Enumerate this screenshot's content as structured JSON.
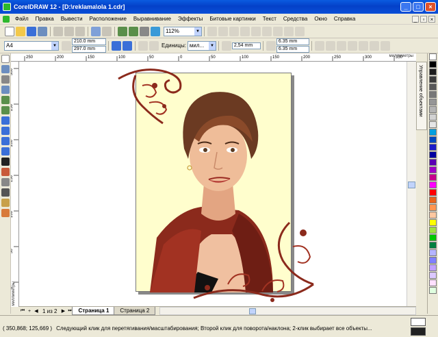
{
  "window": {
    "title": "CorelDRAW 12 - [D:\\reklama\\ola 1.cdr]"
  },
  "menu": [
    "Файл",
    "Правка",
    "Вывести",
    "Расположение",
    "Выравнивание",
    "Эффекты",
    "Битовые картинки",
    "Текст",
    "Средства",
    "Окно",
    "Справка"
  ],
  "toolbar1": {
    "zoom": "112%"
  },
  "toolbar2": {
    "paper": "A4",
    "width": "210.0 mm",
    "height": "297.0 mm",
    "units_label": "Единицы:",
    "units_value": "мил...",
    "nudge": "2,54 mm",
    "dup_x": "6.35 mm",
    "dup_y": "6.35 mm"
  },
  "ruler": {
    "units": "миллиметры",
    "h_ticks": [
      "250",
      "200",
      "150",
      "100",
      "50",
      "0",
      "50",
      "100",
      "150",
      "200",
      "250",
      "300",
      "350"
    ],
    "v_ticks": [
      "300",
      "250",
      "200",
      "150",
      "100",
      "50",
      "0"
    ]
  },
  "docker": {
    "tab": "Управление объектами"
  },
  "pages": {
    "counter": "1 из 2",
    "tabs": [
      "Страница 1",
      "Страница 2"
    ]
  },
  "status": {
    "coords": "( 350,868; 125,669 )",
    "message": "Следующий клик для перетягивания/масштабирования; Второй клик для поворота/наклона; 2-клик выбирает все объекты..."
  },
  "palette": [
    "#ffffff",
    "#000000",
    "#1c1c1c",
    "#3a3a3a",
    "#585858",
    "#777777",
    "#969696",
    "#b4b4b4",
    "#d2d2d2",
    "#e6e6e6",
    "#00a0e0",
    "#0048c0",
    "#1c1cc8",
    "#0000a0",
    "#5a00b4",
    "#a000c8",
    "#c8008c",
    "#ff00ff",
    "#ff0000",
    "#e8641c",
    "#ff9650",
    "#ffc8a0",
    "#ffff00",
    "#a0e040",
    "#00c800",
    "#008040",
    "#b4b4ff",
    "#8080ff",
    "#c0a0ff",
    "#dcc8ff",
    "#ffe0ff",
    "#e0ffe0"
  ]
}
